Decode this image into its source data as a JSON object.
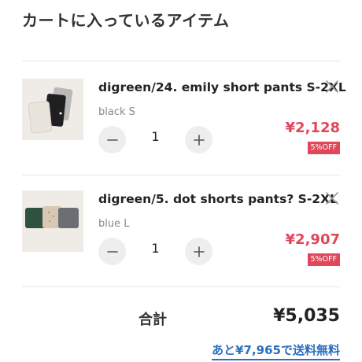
{
  "cart": {
    "title": "カートに入っているアイテム",
    "items": [
      {
        "name": "digreen/24. emily short pants S-2XL",
        "variant": "black S",
        "quantity": "1",
        "price": "¥2,128",
        "discount": "5%OFF",
        "thumb_icon": "product-photo-shorts-stack"
      },
      {
        "name": "digreen/5. dot shorts pants? S-2XL",
        "variant": "blue L",
        "quantity": "1",
        "price": "¥2,907",
        "discount": "5%OFF",
        "thumb_icon": "product-photo-shorts-row"
      }
    ],
    "total_label": "合計",
    "total_value": "¥5,035",
    "free_shipping_link": "あと¥7,965で送料無料"
  },
  "colors": {
    "price": "#e0475a",
    "link": "#2c6fbe",
    "button_bg": "#eeeeee"
  },
  "icons": {
    "remove": "close-icon",
    "decrease": "minus-icon",
    "increase": "plus-icon"
  }
}
